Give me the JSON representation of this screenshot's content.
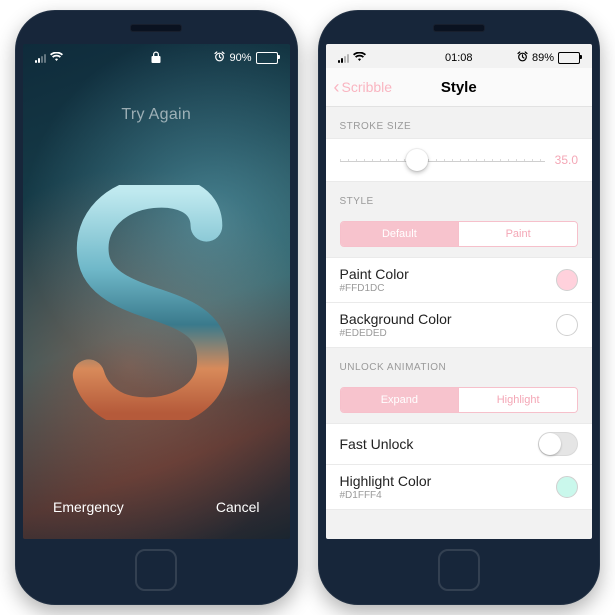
{
  "left": {
    "status": {
      "battery_text": "90%",
      "battery_pct": 90
    },
    "prompt": "Try Again",
    "bottom": {
      "emergency": "Emergency",
      "cancel": "Cancel"
    }
  },
  "right": {
    "status": {
      "time": "01:08",
      "battery_text": "89%",
      "battery_pct": 89
    },
    "nav": {
      "back_label": "Scribble",
      "title": "Style"
    },
    "stroke": {
      "header": "Stroke Size",
      "value_text": "35.0",
      "thumb_pct": 38
    },
    "style": {
      "header": "Style",
      "segments": [
        "Default",
        "Paint"
      ],
      "active_index": 0,
      "paint_color": {
        "label": "Paint Color",
        "hex": "#FFD1DC"
      },
      "background_color": {
        "label": "Background Color",
        "hex": "#EDEDED"
      }
    },
    "unlock": {
      "header": "Unlock Animation",
      "segments": [
        "Expand",
        "Highlight"
      ],
      "active_index": 0,
      "fast_unlock": {
        "label": "Fast Unlock",
        "on": false
      },
      "highlight_color": {
        "label": "Highlight Color",
        "hex": "#D1FFF4",
        "swatch": "#caf8ec"
      }
    }
  }
}
